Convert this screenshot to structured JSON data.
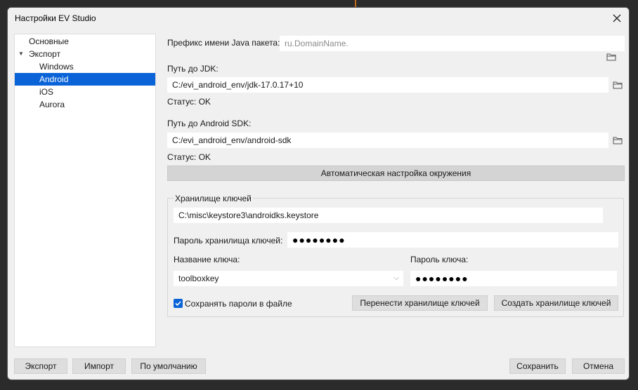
{
  "window": {
    "title": "Настройки EV Studio"
  },
  "tree": {
    "basic": "Основные",
    "export": "Экспорт",
    "windows": "Windows",
    "android": "Android",
    "ios": "iOS",
    "aurora": "Aurora"
  },
  "android": {
    "package_prefix_label": "Префикс имени Java пакета:",
    "package_prefix_placeholder": "ru.DomainName.",
    "jdk_label": "Путь до JDK:",
    "jdk_path": "C:/evi_android_env/jdk-17.0.17+10",
    "jdk_status": "Статус:  OK",
    "sdk_label": "Путь до Android SDK:",
    "sdk_path": "C:/evi_android_env/android-sdk",
    "sdk_status": "Статус: OK",
    "auto_setup_button": "Автоматическая настройка окружения"
  },
  "keystore": {
    "group_title": "Хранилище ключей",
    "path": "C:\\misc\\keystore3\\androidks.keystore",
    "password_label": "Пароль хранилища ключей:",
    "password_value": "●●●●●●●●",
    "key_name_label": "Название ключа:",
    "key_name_value": "toolboxkey",
    "key_password_label": "Пароль ключа:",
    "key_password_value": "●●●●●●●●",
    "save_passwords_label": "Сохранять пароли в файле",
    "save_passwords_checked": true,
    "move_keystore_button": "Перенести хранилище ключей",
    "create_keystore_button": "Создать хранилище ключей"
  },
  "footer": {
    "export_button": "Экспорт",
    "import_button": "Импорт",
    "defaults_button": "По умолчанию",
    "save_button": "Сохранить",
    "cancel_button": "Отмена"
  },
  "colors": {
    "accent": "#0a64d8",
    "dialog_bg": "#f0f0f0"
  }
}
